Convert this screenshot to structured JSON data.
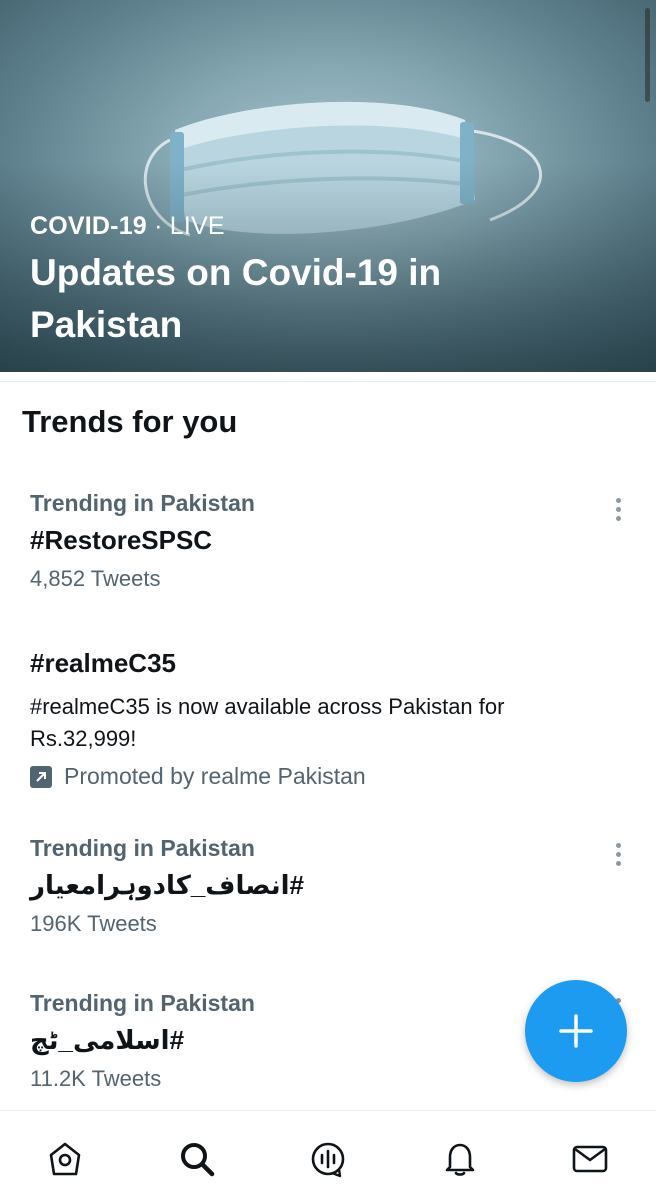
{
  "hero": {
    "category": "COVID-19",
    "separator": " · ",
    "status": "LIVE",
    "title": "Updates on Covid-19 in Pakistan"
  },
  "trends_section": {
    "title": "Trends for you",
    "items": [
      {
        "meta": "Trending in Pakistan",
        "name": "#RestoreSPSC",
        "count": "4,852 Tweets"
      },
      {
        "name": "#realmeC35",
        "description": "#realmeC35 is now available across Pakistan for Rs.32,999!",
        "promoted": "Promoted by realme Pakistan"
      },
      {
        "meta": "Trending in Pakistan",
        "name": "#انصاف_کادوہرامعیار",
        "count": "196K Tweets"
      },
      {
        "meta": "Trending in Pakistan",
        "name": "#اسلامی_ٹچ",
        "count": "11.2K Tweets"
      }
    ]
  },
  "fab": {
    "icon": "plus-icon"
  },
  "bottom_nav": {
    "items": [
      "home-icon",
      "search-icon",
      "spaces-icon",
      "notifications-icon",
      "messages-icon"
    ]
  },
  "colors": {
    "accent": "#1d9bf0",
    "secondary_text": "#536471",
    "primary_text": "#0f1419"
  }
}
